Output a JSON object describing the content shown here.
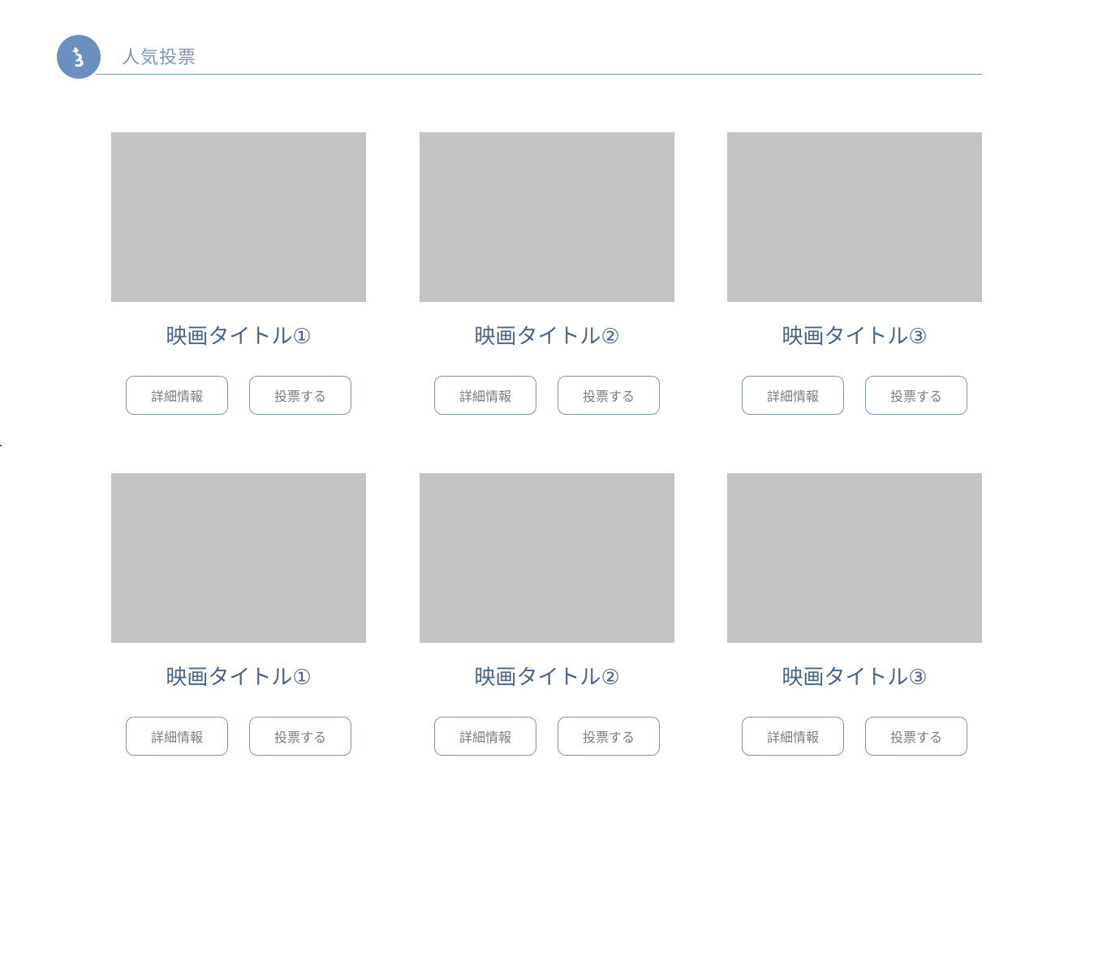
{
  "header": {
    "icon": "voting-hand-icon",
    "title": "人気投票"
  },
  "colors": {
    "accent": "#6b8fbf",
    "title_text": "#4a6587",
    "placeholder": "#c3c3c3",
    "button_border": "#8296ab"
  },
  "movies": [
    {
      "title": "映画タイトル①",
      "detail_label": "詳細情報",
      "vote_label": "投票する"
    },
    {
      "title": "映画タイトル②",
      "detail_label": "詳細情報",
      "vote_label": "投票する"
    },
    {
      "title": "映画タイトル③",
      "detail_label": "詳細情報",
      "vote_label": "投票する"
    },
    {
      "title": "映画タイトル①",
      "detail_label": "詳細情報",
      "vote_label": "投票する"
    },
    {
      "title": "映画タイトル②",
      "detail_label": "詳細情報",
      "vote_label": "投票する"
    },
    {
      "title": "映画タイトル③",
      "detail_label": "詳細情報",
      "vote_label": "投票する"
    }
  ]
}
